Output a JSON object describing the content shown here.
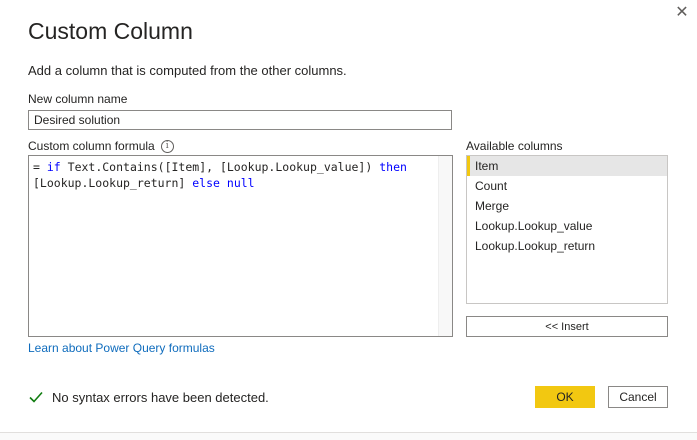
{
  "dialog": {
    "title": "Custom Column",
    "subtitle": "Add a column that is computed from the other columns.",
    "close_glyph": "✕"
  },
  "new_column": {
    "label": "New column name",
    "value": "Desired solution"
  },
  "formula": {
    "label": "Custom column formula",
    "info_glyph": "i",
    "line1": {
      "prefix": "= ",
      "kw_if": "if",
      "mid": " Text.Contains([Item], [Lookup.Lookup_value]) ",
      "kw_then": "then"
    },
    "line2": {
      "pre": "[Lookup.Lookup_return] ",
      "kw_else": "else",
      "space": " ",
      "kw_null": "null"
    }
  },
  "learn_link": "Learn about Power Query formulas",
  "available": {
    "label": "Available columns",
    "items": [
      "Item",
      "Count",
      "Merge",
      "Lookup.Lookup_value",
      "Lookup.Lookup_return"
    ],
    "selected": "Item"
  },
  "insert_label": "<< Insert",
  "status": {
    "text": "No syntax errors have been detected.",
    "icon": "check-icon",
    "color": "#107c10"
  },
  "buttons": {
    "ok": "OK",
    "cancel": "Cancel"
  },
  "colors": {
    "accent": "#f2c811",
    "link": "#0f6cbd",
    "keyword": "#0000ff"
  }
}
